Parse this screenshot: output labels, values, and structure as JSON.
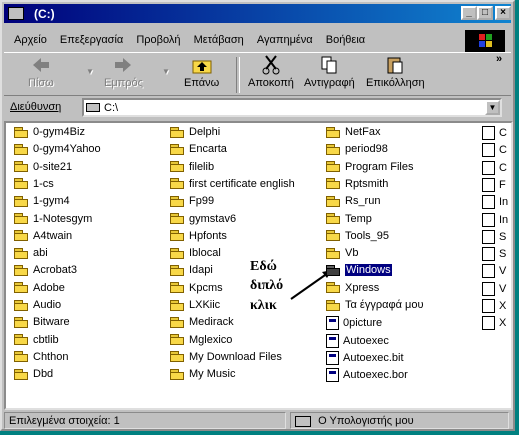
{
  "window": {
    "title": "(C:)"
  },
  "title_buttons": {
    "minimize": "_",
    "maximize": "□",
    "close": "×"
  },
  "menu": [
    "Αρχείο",
    "Επεξεργασία",
    "Προβολή",
    "Μετάβαση",
    "Αγαπημένα",
    "Βοήθεια"
  ],
  "toolbar": {
    "back": "Πίσω",
    "forward": "Εμπρός",
    "up": "Επάνω",
    "cut": "Αποκοπή",
    "copy": "Αντιγραφή",
    "paste": "Επικόλληση",
    "more": "»"
  },
  "address": {
    "label": "Διεύθυνση",
    "value": "C:\\"
  },
  "columns": [
    [
      "0-gym4Biz",
      "0-gym4Yahoo",
      "0-site21",
      "1-cs",
      "1-gym4",
      "1-Notesgym",
      "A4twain",
      "abi",
      "Acrobat3",
      "Adobe",
      "Audio",
      "Bitware",
      "cbtlib",
      "Chthon",
      "Dbd"
    ],
    [
      "Delphi",
      "Encarta",
      "filelib",
      "first certificate english",
      "Fp99",
      "gymstav6",
      "Hpfonts",
      "Iblocal",
      "Idapi",
      "Kpcms",
      "LXKiic",
      "Medirack",
      "Mglexico",
      "My Download Files",
      "My Music"
    ],
    [
      "NetFax",
      "period98",
      "Program Files",
      "Rptsmith",
      "Rs_run",
      "Temp",
      "Tools_95",
      "Vb",
      "Windows",
      "Xpress",
      "Τα έγγραφά μου",
      "0picture",
      "Autoexec",
      "Autoexec.bit",
      "Autoexec.bor"
    ]
  ],
  "col4": [
    "C",
    "C",
    "C",
    "F",
    "In",
    "In",
    "S",
    "S",
    "V",
    "V",
    "X",
    "X"
  ],
  "selected": "Windows",
  "annotation": [
    "Εδώ",
    "διπλό",
    "κλικ"
  ],
  "status": {
    "left": "Επιλεγμένα στοιχεία: 1",
    "right": "Ο Υπολογιστής μου"
  },
  "colors": {
    "title_bar": "#000080",
    "selection": "#000080",
    "face": "#c0c0c0"
  }
}
